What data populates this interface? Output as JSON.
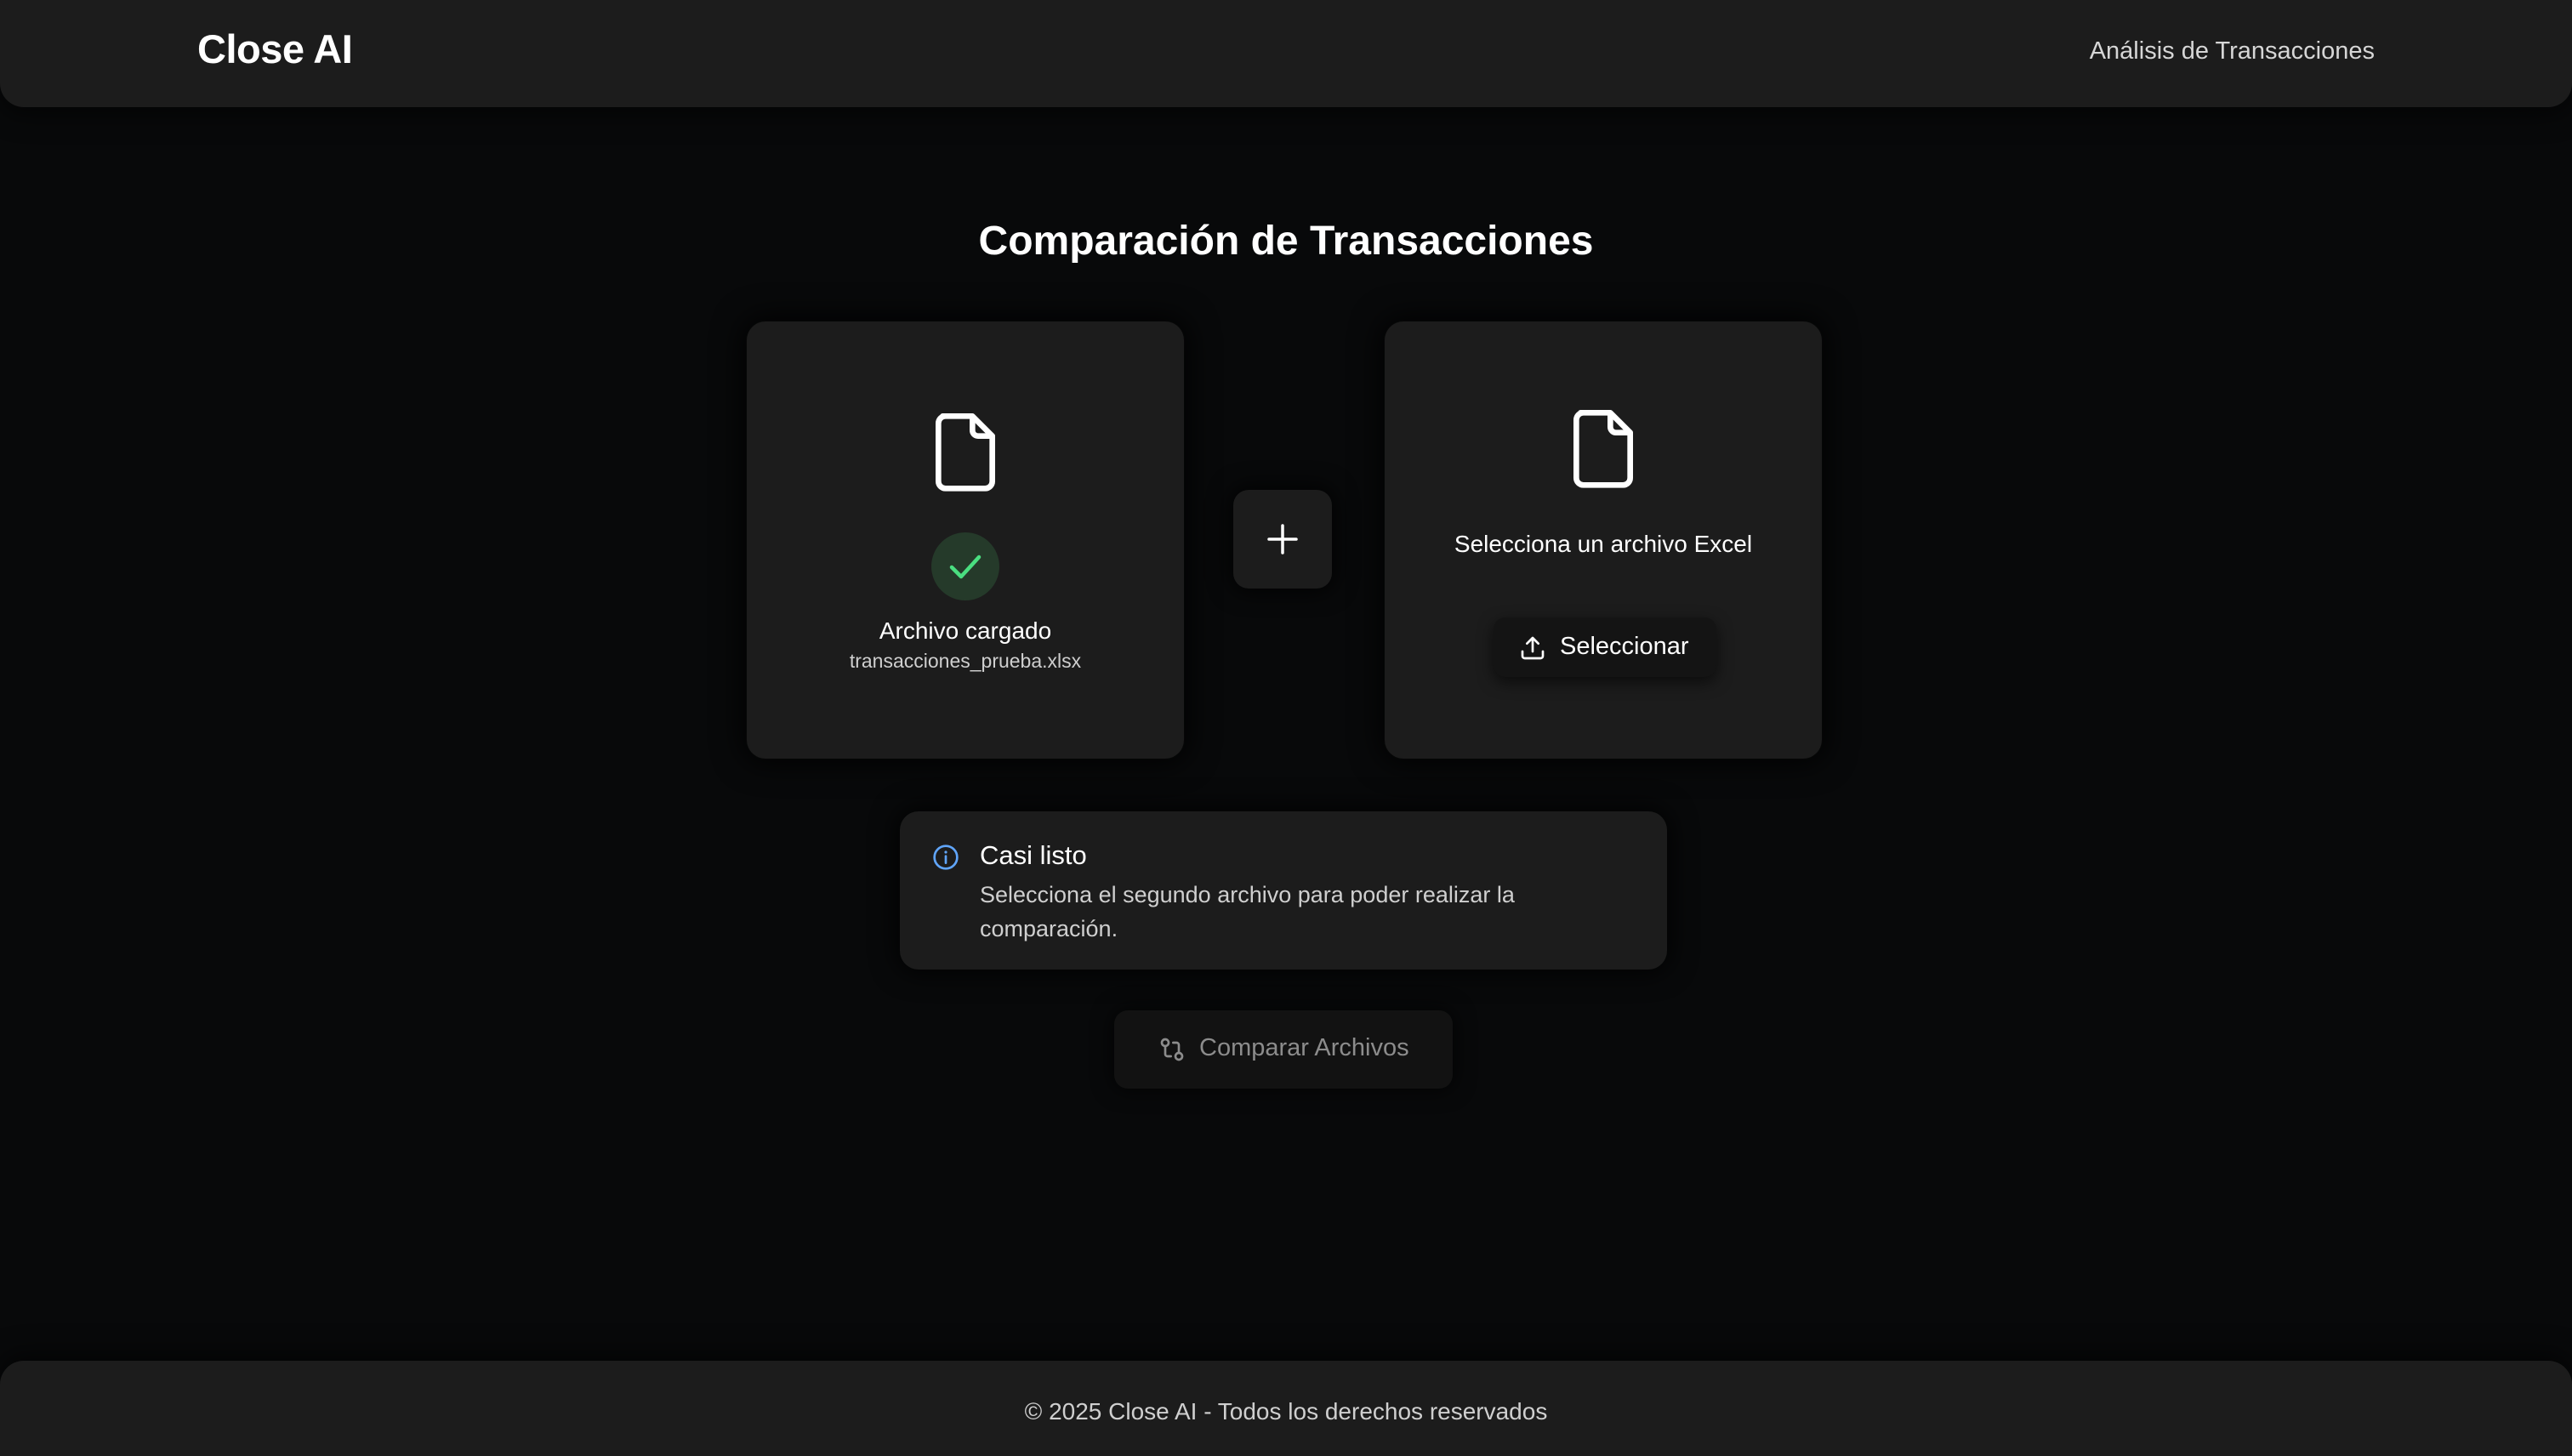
{
  "header": {
    "brand": "Close AI",
    "nav_link": "Análisis de Transacciones"
  },
  "main": {
    "title": "Comparación de Transacciones",
    "file_one": {
      "icon": "file-icon",
      "status_icon": "check-icon",
      "status_label": "Archivo cargado",
      "file_name": "transacciones_prueba.xlsx"
    },
    "plus_icon": "plus-icon",
    "file_two": {
      "icon": "file-icon",
      "hint": "Selecciona un archivo Excel",
      "button_icon": "upload-icon",
      "button_label": "Seleccionar"
    },
    "info": {
      "icon": "info-icon",
      "title": "Casi listo",
      "text": "Selecciona el segundo archivo para poder realizar la comparación."
    },
    "compare_button": {
      "icon": "git-compare-icon",
      "label": "Comparar Archivos",
      "disabled": true
    }
  },
  "footer": {
    "text": "© 2025 Close AI - Todos los derechos reservados"
  },
  "colors": {
    "background": "#08090a",
    "surface": "#1c1c1c",
    "success_badge": "#253a2a",
    "success_check": "#4ade80",
    "info_accent": "#60a5fa",
    "muted_text": "#8c8c8c"
  }
}
